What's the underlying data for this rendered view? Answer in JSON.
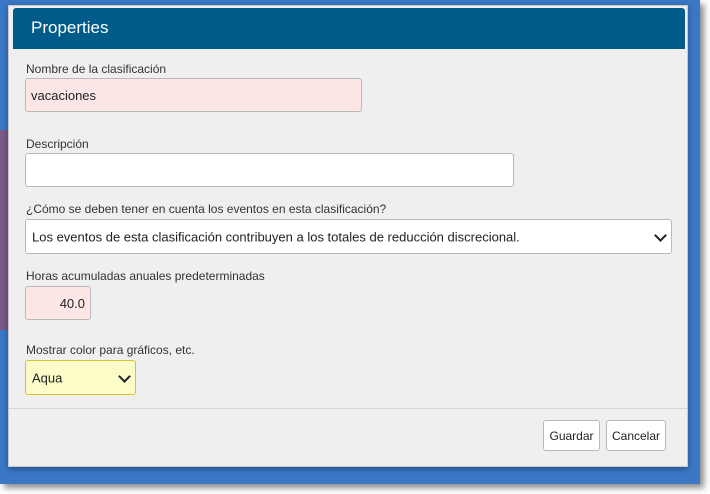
{
  "dialog": {
    "title": "Properties"
  },
  "form": {
    "name_label": "Nombre de la clasificación",
    "name_value": "vacaciones",
    "description_label": "Descripción",
    "description_value": "",
    "evaluation_label": "¿Cómo se deben tener en cuenta los eventos en esta clasificación?",
    "evaluation_selected": "Los eventos de esta clasificación contribuyen a los totales de reducción discrecional.",
    "hours_label": "Horas acumuladas anuales predeterminadas",
    "hours_value": "40.0",
    "color_label": "Mostrar color para gráficos, etc.",
    "color_selected": "Aqua"
  },
  "footer": {
    "save_label": "Guardar",
    "cancel_label": "Cancelar"
  },
  "colors": {
    "header": "#005b8a",
    "required_field": "#fde6e6",
    "color_field": "#fcfcc8",
    "frame": "#3a78c6"
  },
  "icons": {
    "select_arrow": "chevron-down-icon"
  }
}
